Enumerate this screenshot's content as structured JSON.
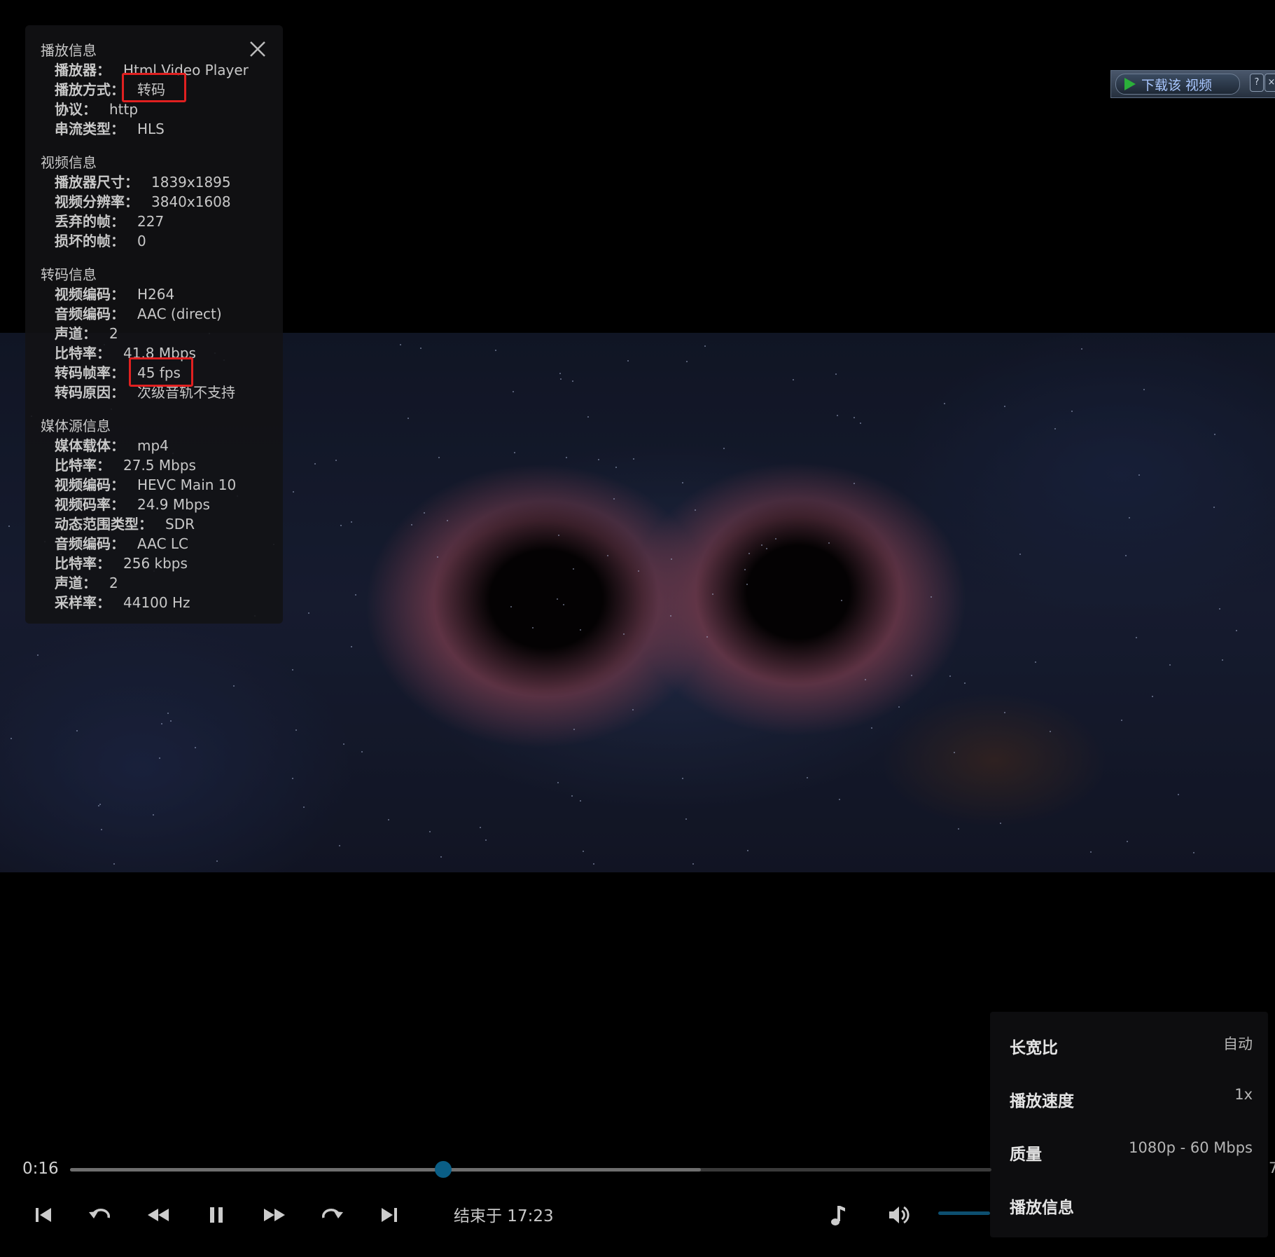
{
  "info_panel": {
    "sections": {
      "playback": {
        "title": "播放信息",
        "player_label": "播放器：",
        "player_value": "Html Video Player",
        "method_label": "播放方式：",
        "method_value": "转码",
        "protocol_label": "协议：",
        "protocol_value": "http",
        "stream_label": "串流类型：",
        "stream_value": "HLS"
      },
      "video": {
        "title": "视频信息",
        "player_size_label": "播放器尺寸：",
        "player_size_value": "1839x1895",
        "resolution_label": "视频分辨率：",
        "resolution_value": "3840x1608",
        "dropped_label": "丢弃的帧：",
        "dropped_value": "227",
        "corrupted_label": "损坏的帧：",
        "corrupted_value": "0"
      },
      "transcode": {
        "title": "转码信息",
        "vcodec_label": "视频编码：",
        "vcodec_value": "H264",
        "acodec_label": "音频编码：",
        "acodec_value": "AAC (direct)",
        "channels_label": "声道：",
        "channels_value": "2",
        "bitrate_label": "比特率：",
        "bitrate_value": "41.8 Mbps",
        "framerate_label": "转码帧率：",
        "framerate_value": "45 fps",
        "reason_label": "转码原因：",
        "reason_value": "次级音轨不支持"
      },
      "source": {
        "title": "媒体源信息",
        "container_label": "媒体载体：",
        "container_value": "mp4",
        "bitrate_label": "比特率：",
        "bitrate_value": "27.5 Mbps",
        "vcodec_label": "视频编码：",
        "vcodec_value": "HEVC Main 10",
        "vbitrate_label": "视频码率：",
        "vbitrate_value": "24.9 Mbps",
        "range_label": "动态范围类型：",
        "range_value": "SDR",
        "acodec_label": "音频编码：",
        "acodec_value": "AAC LC",
        "abitrate_label": "比特率：",
        "abitrate_value": "256 kbps",
        "channels_label": "声道：",
        "channels_value": "2",
        "samplerate_label": "采样率：",
        "samplerate_value": "44100 Hz"
      }
    },
    "close_icon": "close-icon"
  },
  "download_widget": {
    "button_label": "下载该 视频",
    "help_label": "?",
    "close_label": "×"
  },
  "settings_menu": {
    "items": [
      {
        "label": "长宽比",
        "value": "自动"
      },
      {
        "label": "播放速度",
        "value": "1x"
      },
      {
        "label": "质量",
        "value": "1080p - 60 Mbps"
      },
      {
        "label": "播放信息",
        "value": ""
      }
    ]
  },
  "player": {
    "current_time": "0:16",
    "edge_text": "7",
    "end_time": "结束于 17:23",
    "progress_fraction": 0.405,
    "buffer_fraction": 0.685,
    "accent_color": "#0a5e86",
    "highlight_color": "#e02020",
    "controls": [
      "previous-track-icon",
      "replay-icon",
      "rewind-icon",
      "pause-icon",
      "fast-forward-icon",
      "redo-icon",
      "next-track-icon",
      "music-note-icon",
      "volume-icon"
    ]
  }
}
